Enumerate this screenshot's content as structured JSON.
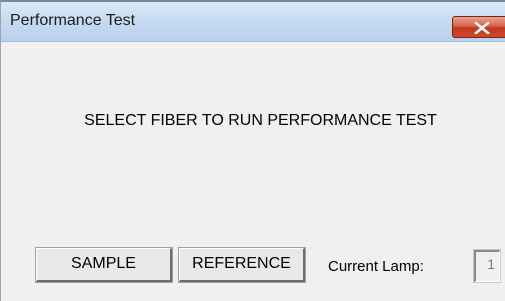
{
  "window": {
    "title": "Performance Test",
    "close_icon": "close-icon"
  },
  "message": "SELECT FIBER TO RUN PERFORMANCE TEST",
  "buttons": {
    "sample_label": "SAMPLE",
    "reference_label": "REFERENCE"
  },
  "lamp": {
    "label": "Current Lamp:",
    "value": "1"
  },
  "colors": {
    "dialog_background": "#f0f0f0",
    "close_button": "#c4361d",
    "titlebar": "#c7dcf2"
  }
}
